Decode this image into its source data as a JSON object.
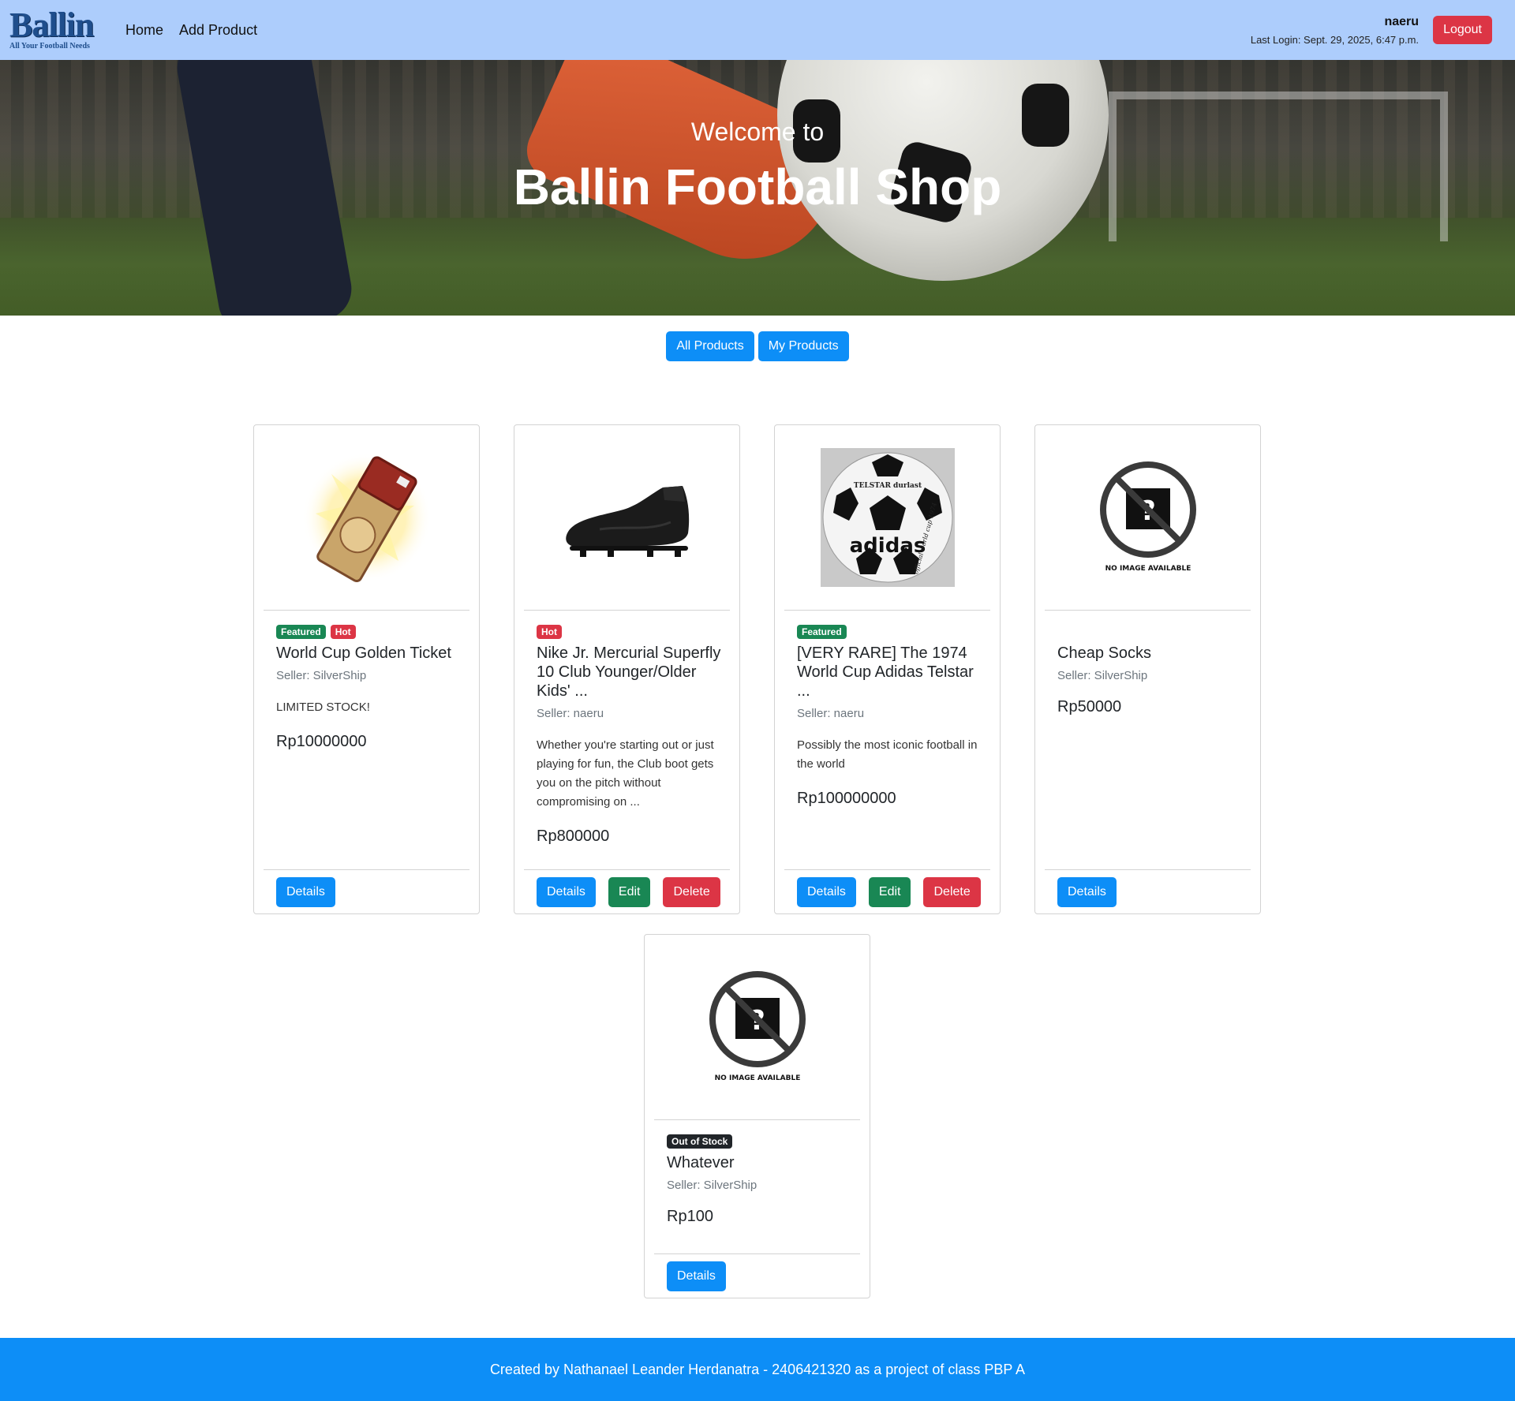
{
  "nav": {
    "logo_text": "Ballin",
    "logo_tagline": "All Your Football Needs",
    "links": [
      "Home",
      "Add Product"
    ],
    "username": "naeru",
    "last_login": "Last Login: Sept. 29, 2025, 6:47 p.m.",
    "logout_label": "Logout"
  },
  "hero": {
    "subtitle": "Welcome to",
    "title": "Ballin Football Shop"
  },
  "filters": [
    "All Products",
    "My Products"
  ],
  "products": [
    {
      "badges": [
        "Featured",
        "Hot"
      ],
      "title": "World Cup Golden Ticket",
      "seller": "Seller: SilverShip",
      "description": "LIMITED STOCK!",
      "price": "Rp10000000",
      "image": "golden-ticket",
      "actions": [
        "Details"
      ]
    },
    {
      "badges": [
        "Hot"
      ],
      "title": "Nike Jr. Mercurial Superfly 10 Club Younger/Older Kids' ...",
      "seller": "Seller: naeru",
      "description": "Whether you're starting out or just playing for fun, the Club boot gets you on the pitch without compromising on ...",
      "price": "Rp800000",
      "image": "black-football-boot",
      "actions": [
        "Details",
        "Edit",
        "Delete"
      ]
    },
    {
      "badges": [
        "Featured"
      ],
      "title": "[VERY RARE] The 1974 World Cup Adidas Telstar ...",
      "seller": "Seller: naeru",
      "description": "Possibly the most iconic football in the world",
      "price": "Rp100000000",
      "image": "adidas-telstar-ball",
      "actions": [
        "Details",
        "Edit",
        "Delete"
      ]
    },
    {
      "badges": [],
      "title": "Cheap Socks",
      "seller": "Seller: SilverShip",
      "description": "",
      "price": "Rp50000",
      "image": "no-image",
      "actions": [
        "Details"
      ]
    },
    {
      "badges": [
        "Out of Stock"
      ],
      "title": "Whatever",
      "seller": "Seller: SilverShip",
      "description": "",
      "price": "Rp100",
      "image": "no-image",
      "actions": [
        "Details"
      ]
    }
  ],
  "no_image_text": "NO IMAGE AVAILABLE",
  "ball_print": {
    "brand": "adidas",
    "edition": "official world cup 1974",
    "model": "TELSTAR durlast"
  },
  "footer": {
    "text": "Created by Nathanael Leander Herdanatra - 2406421320 as a project of class PBP A"
  },
  "colors": {
    "navbar_bg": "#adcdfc",
    "primary": "#0d8ef7",
    "success": "#198754",
    "danger": "#dc3545",
    "dark": "#212529"
  }
}
